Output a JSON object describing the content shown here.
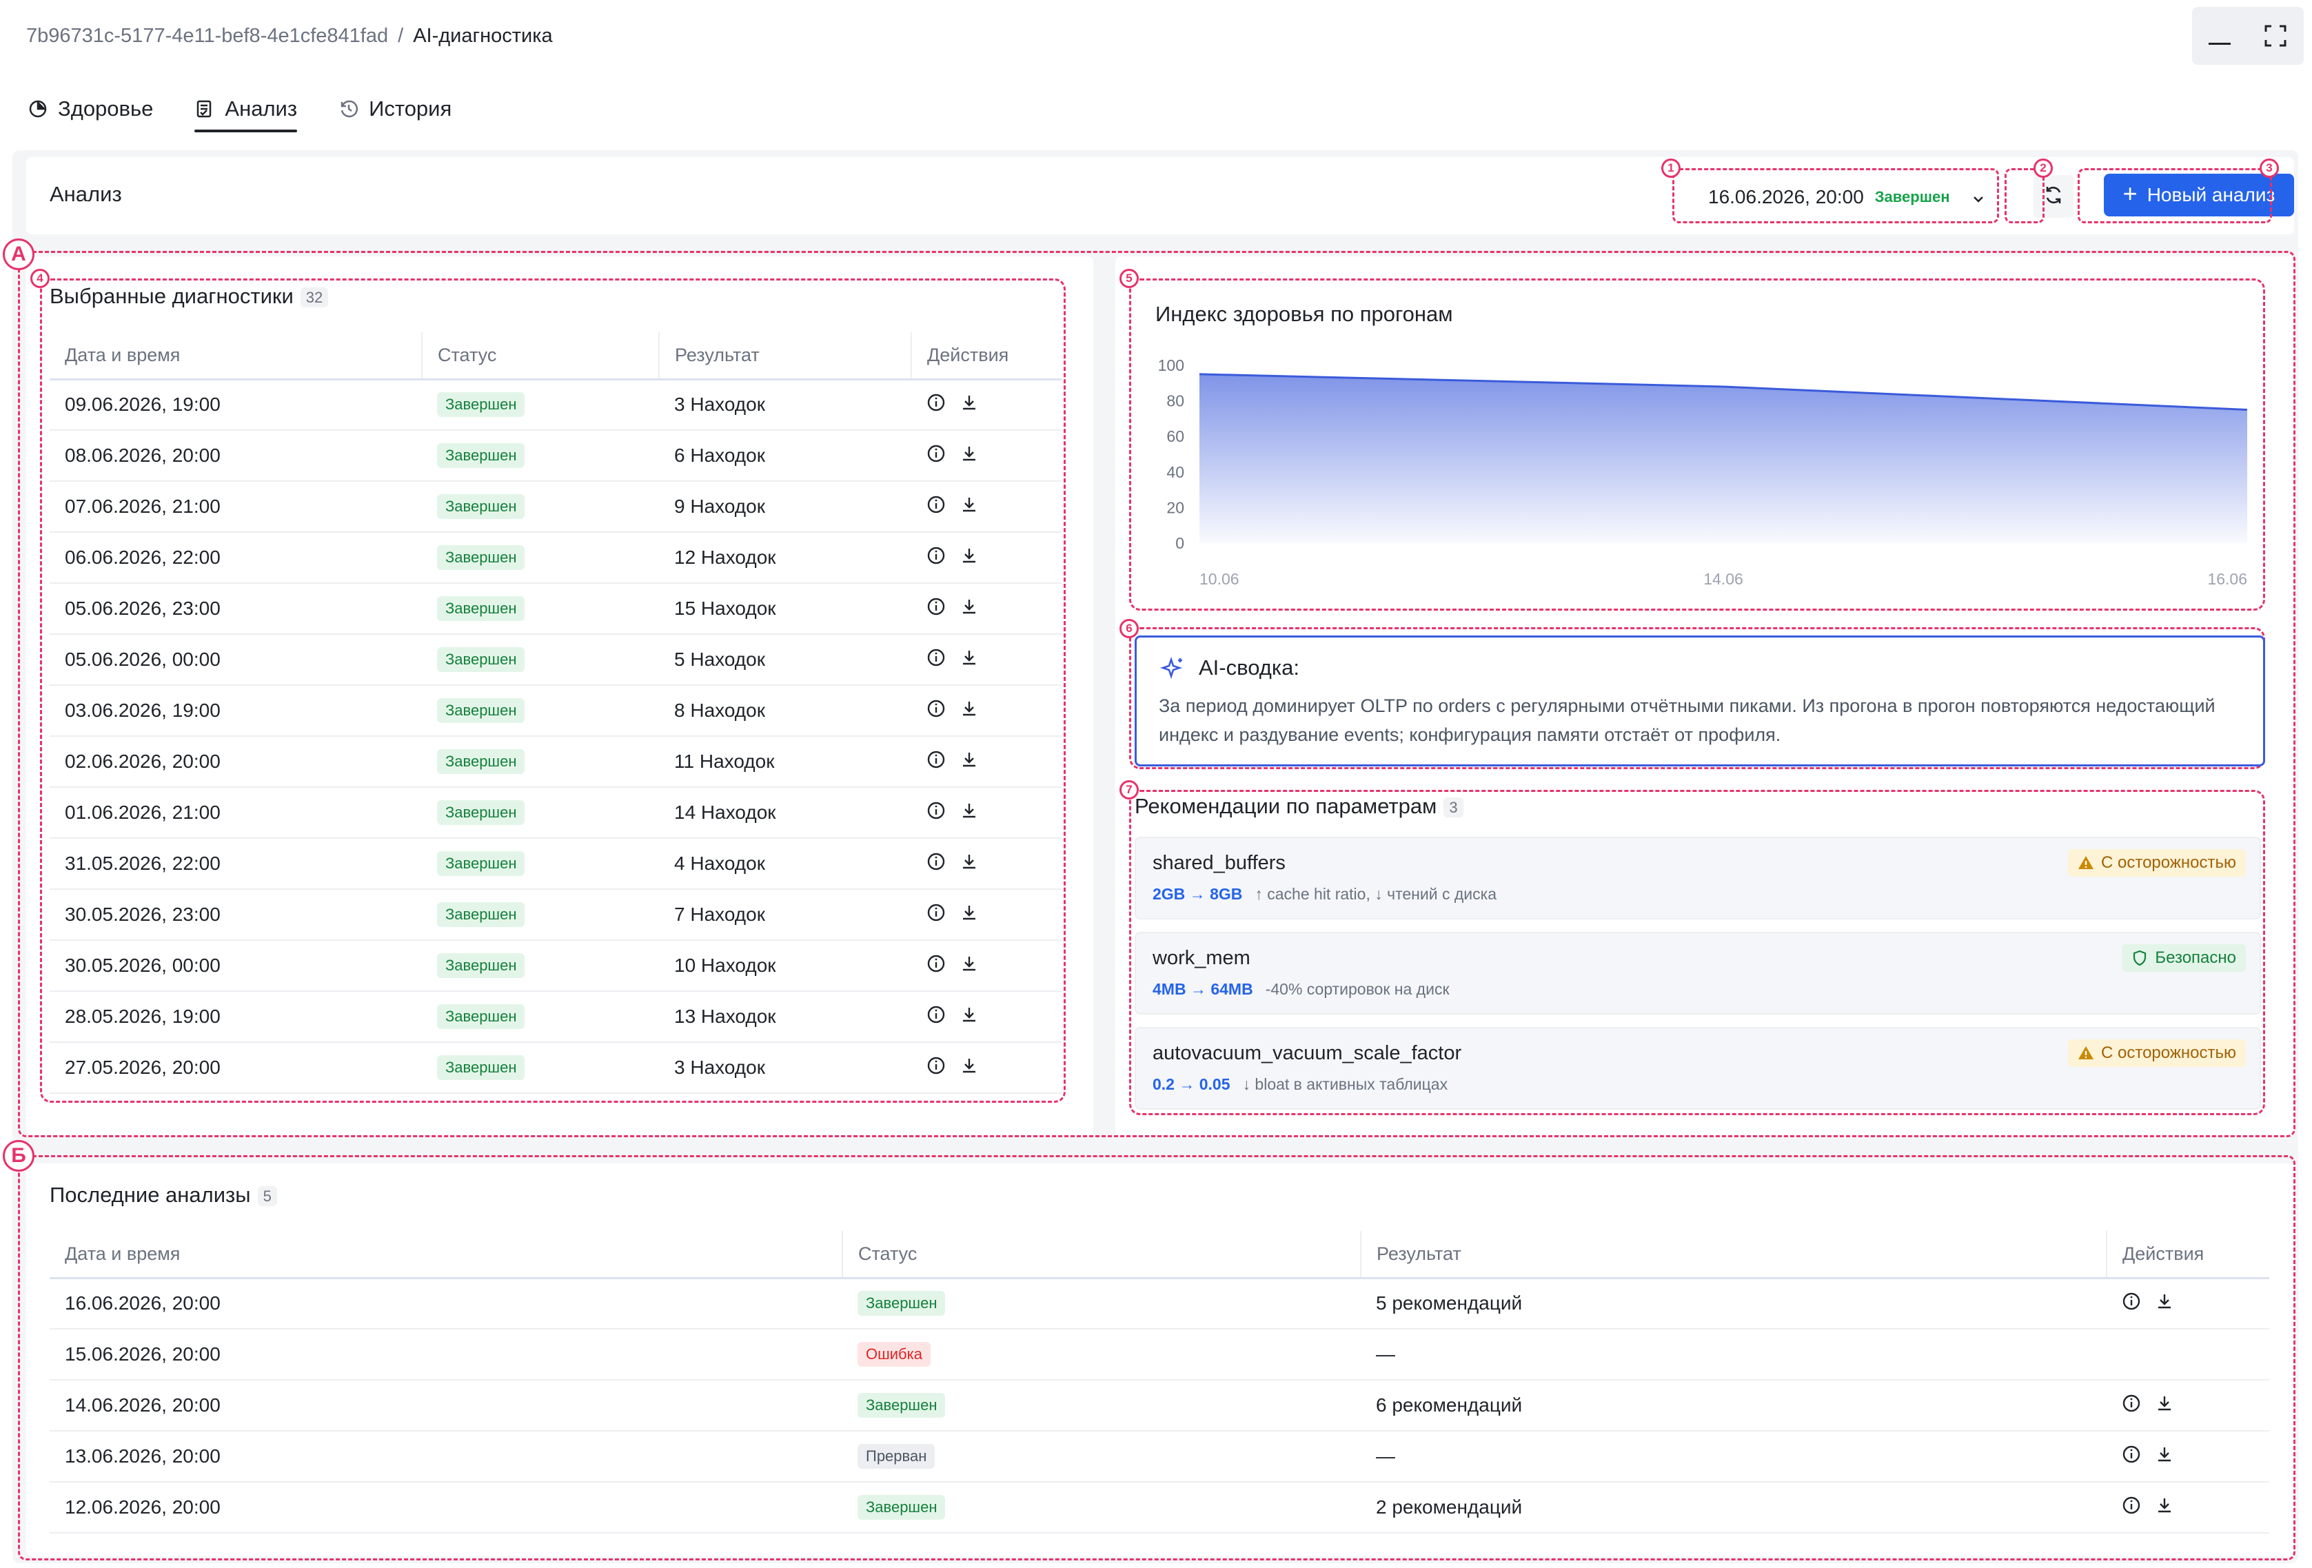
{
  "breadcrumb": {
    "id": "7b96731c-5177-4e11-bef8-4e1cfe841fad",
    "separator": "/",
    "current": "AI-диагностика"
  },
  "tabs": [
    {
      "label": "Здоровье",
      "icon": "pie-chart-icon"
    },
    {
      "label": "Анализ",
      "icon": "report-icon",
      "active": true
    },
    {
      "label": "История",
      "icon": "history-icon"
    }
  ],
  "toolbar": {
    "title": "Анализ",
    "selected_run": "16.06.2026, 20:00",
    "selected_status": "Завершен",
    "new_label": "Новый анализ"
  },
  "markers": {
    "zone_a": "А",
    "zone_b": "Б",
    "n1": "1",
    "n2": "2",
    "n3": "3",
    "n4": "4",
    "n5": "5",
    "n6": "6",
    "n7": "7"
  },
  "selected_diagnostics": {
    "title": "Выбранные диагностики",
    "count": "32",
    "columns": [
      "Дата и время",
      "Статус",
      "Результат",
      "Действия"
    ],
    "rows": [
      {
        "date": "09.06.2026, 19:00",
        "status": "Завершен",
        "result": "3 Находок"
      },
      {
        "date": "08.06.2026, 20:00",
        "status": "Завершен",
        "result": "6 Находок"
      },
      {
        "date": "07.06.2026, 21:00",
        "status": "Завершен",
        "result": "9 Находок"
      },
      {
        "date": "06.06.2026, 22:00",
        "status": "Завершен",
        "result": "12 Находок"
      },
      {
        "date": "05.06.2026, 23:00",
        "status": "Завершен",
        "result": "15 Находок"
      },
      {
        "date": "05.06.2026, 00:00",
        "status": "Завершен",
        "result": "5 Находок"
      },
      {
        "date": "03.06.2026, 19:00",
        "status": "Завершен",
        "result": "8 Находок"
      },
      {
        "date": "02.06.2026, 20:00",
        "status": "Завершен",
        "result": "11 Находок"
      },
      {
        "date": "01.06.2026, 21:00",
        "status": "Завершен",
        "result": "14 Находок"
      },
      {
        "date": "31.05.2026, 22:00",
        "status": "Завершен",
        "result": "4 Находок"
      },
      {
        "date": "30.05.2026, 23:00",
        "status": "Завершен",
        "result": "7 Находок"
      },
      {
        "date": "30.05.2026, 00:00",
        "status": "Завершен",
        "result": "10 Находок"
      },
      {
        "date": "28.05.2026, 19:00",
        "status": "Завершен",
        "result": "13 Находок"
      },
      {
        "date": "27.05.2026, 20:00",
        "status": "Завершен",
        "result": "3 Находок"
      }
    ]
  },
  "chart_data": {
    "type": "area",
    "title": "Индекс здоровья по прогонам",
    "x": [
      "10.06",
      "14.06",
      "16.06"
    ],
    "series": [
      {
        "values": [
          95,
          88,
          75
        ]
      }
    ],
    "ylim": [
      0,
      100
    ],
    "yticks": [
      "100",
      "80",
      "60",
      "40",
      "20",
      "0"
    ],
    "color": "#3b5bdb"
  },
  "ai_summary": {
    "title": "AI-сводка:",
    "text": "За период доминирует OLTP по orders с регулярными отчётными пиками. Из прогона в прогон повторяются недостающий индекс и раздувание events; конфигурация памяти отстаёт от профиля."
  },
  "recommendations": {
    "title": "Рекомендации по параметрам",
    "count": "3",
    "items": [
      {
        "name": "shared_buffers",
        "change": "2GB → 8GB",
        "effect": "↑ cache hit ratio, ↓ чтений с диска",
        "tag": "С осторожностью",
        "tag_type": "warn"
      },
      {
        "name": "work_mem",
        "change": "4MB → 64MB",
        "effect": "-40% сортировок на диск",
        "tag": "Безопасно",
        "tag_type": "safe"
      },
      {
        "name": "autovacuum_vacuum_scale_factor",
        "change": "0.2 → 0.05",
        "effect": "↓ bloat в активных таблицах",
        "tag": "С осторожностью",
        "tag_type": "warn"
      }
    ]
  },
  "recent_analyses": {
    "title": "Последние анализы",
    "count": "5",
    "columns": [
      "Дата и время",
      "Статус",
      "Результат",
      "Действия"
    ],
    "rows": [
      {
        "date": "16.06.2026, 20:00",
        "status": "Завершен",
        "status_type": "green",
        "result": "5 рекомендаций",
        "actions": true
      },
      {
        "date": "15.06.2026, 20:00",
        "status": "Ошибка",
        "status_type": "red",
        "result": "—",
        "actions": false
      },
      {
        "date": "14.06.2026, 20:00",
        "status": "Завершен",
        "status_type": "green",
        "result": "6 рекомендаций",
        "actions": true
      },
      {
        "date": "13.06.2026, 20:00",
        "status": "Прерван",
        "status_type": "grey",
        "result": "—",
        "actions": true
      },
      {
        "date": "12.06.2026, 20:00",
        "status": "Завершен",
        "status_type": "green",
        "result": "2 рекомендаций",
        "actions": true
      }
    ]
  }
}
